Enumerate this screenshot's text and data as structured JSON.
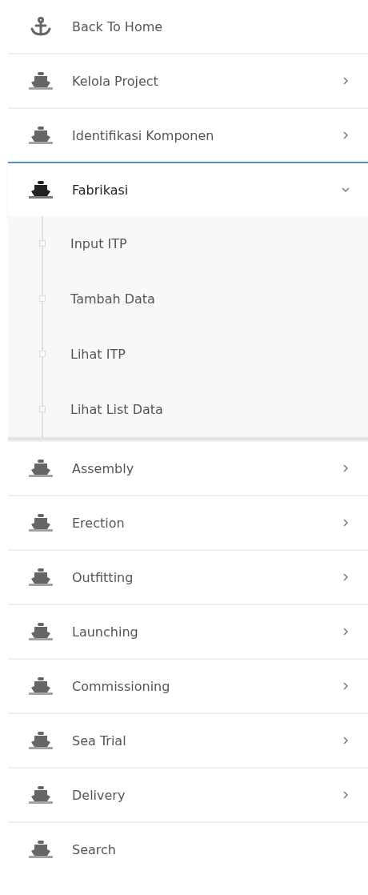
{
  "menu": [
    {
      "label": "Back To Home",
      "kind": "home",
      "selected": false
    },
    {
      "label": "Kelola Project",
      "kind": "menu",
      "selected": false,
      "expanded": false
    },
    {
      "label": "Identifikasi Komponen",
      "kind": "menu",
      "selected": false,
      "expanded": false
    },
    {
      "label": "Fabrikasi",
      "kind": "menu",
      "selected": true,
      "expanded": true,
      "children": [
        {
          "label": "Input ITP"
        },
        {
          "label": "Tambah Data"
        },
        {
          "label": "Lihat ITP"
        },
        {
          "label": "Lihat List Data"
        }
      ]
    },
    {
      "label": "Assembly",
      "kind": "menu",
      "selected": false,
      "expanded": false
    },
    {
      "label": "Erection",
      "kind": "menu",
      "selected": false,
      "expanded": false
    },
    {
      "label": "Outfitting",
      "kind": "menu",
      "selected": false,
      "expanded": false
    },
    {
      "label": "Launching",
      "kind": "menu",
      "selected": false,
      "expanded": false
    },
    {
      "label": "Commissioning",
      "kind": "menu",
      "selected": false,
      "expanded": false
    },
    {
      "label": "Sea Trial",
      "kind": "menu",
      "selected": false,
      "expanded": false
    },
    {
      "label": "Delivery",
      "kind": "menu",
      "selected": false,
      "expanded": false
    },
    {
      "label": "Search",
      "kind": "link",
      "selected": false
    }
  ]
}
